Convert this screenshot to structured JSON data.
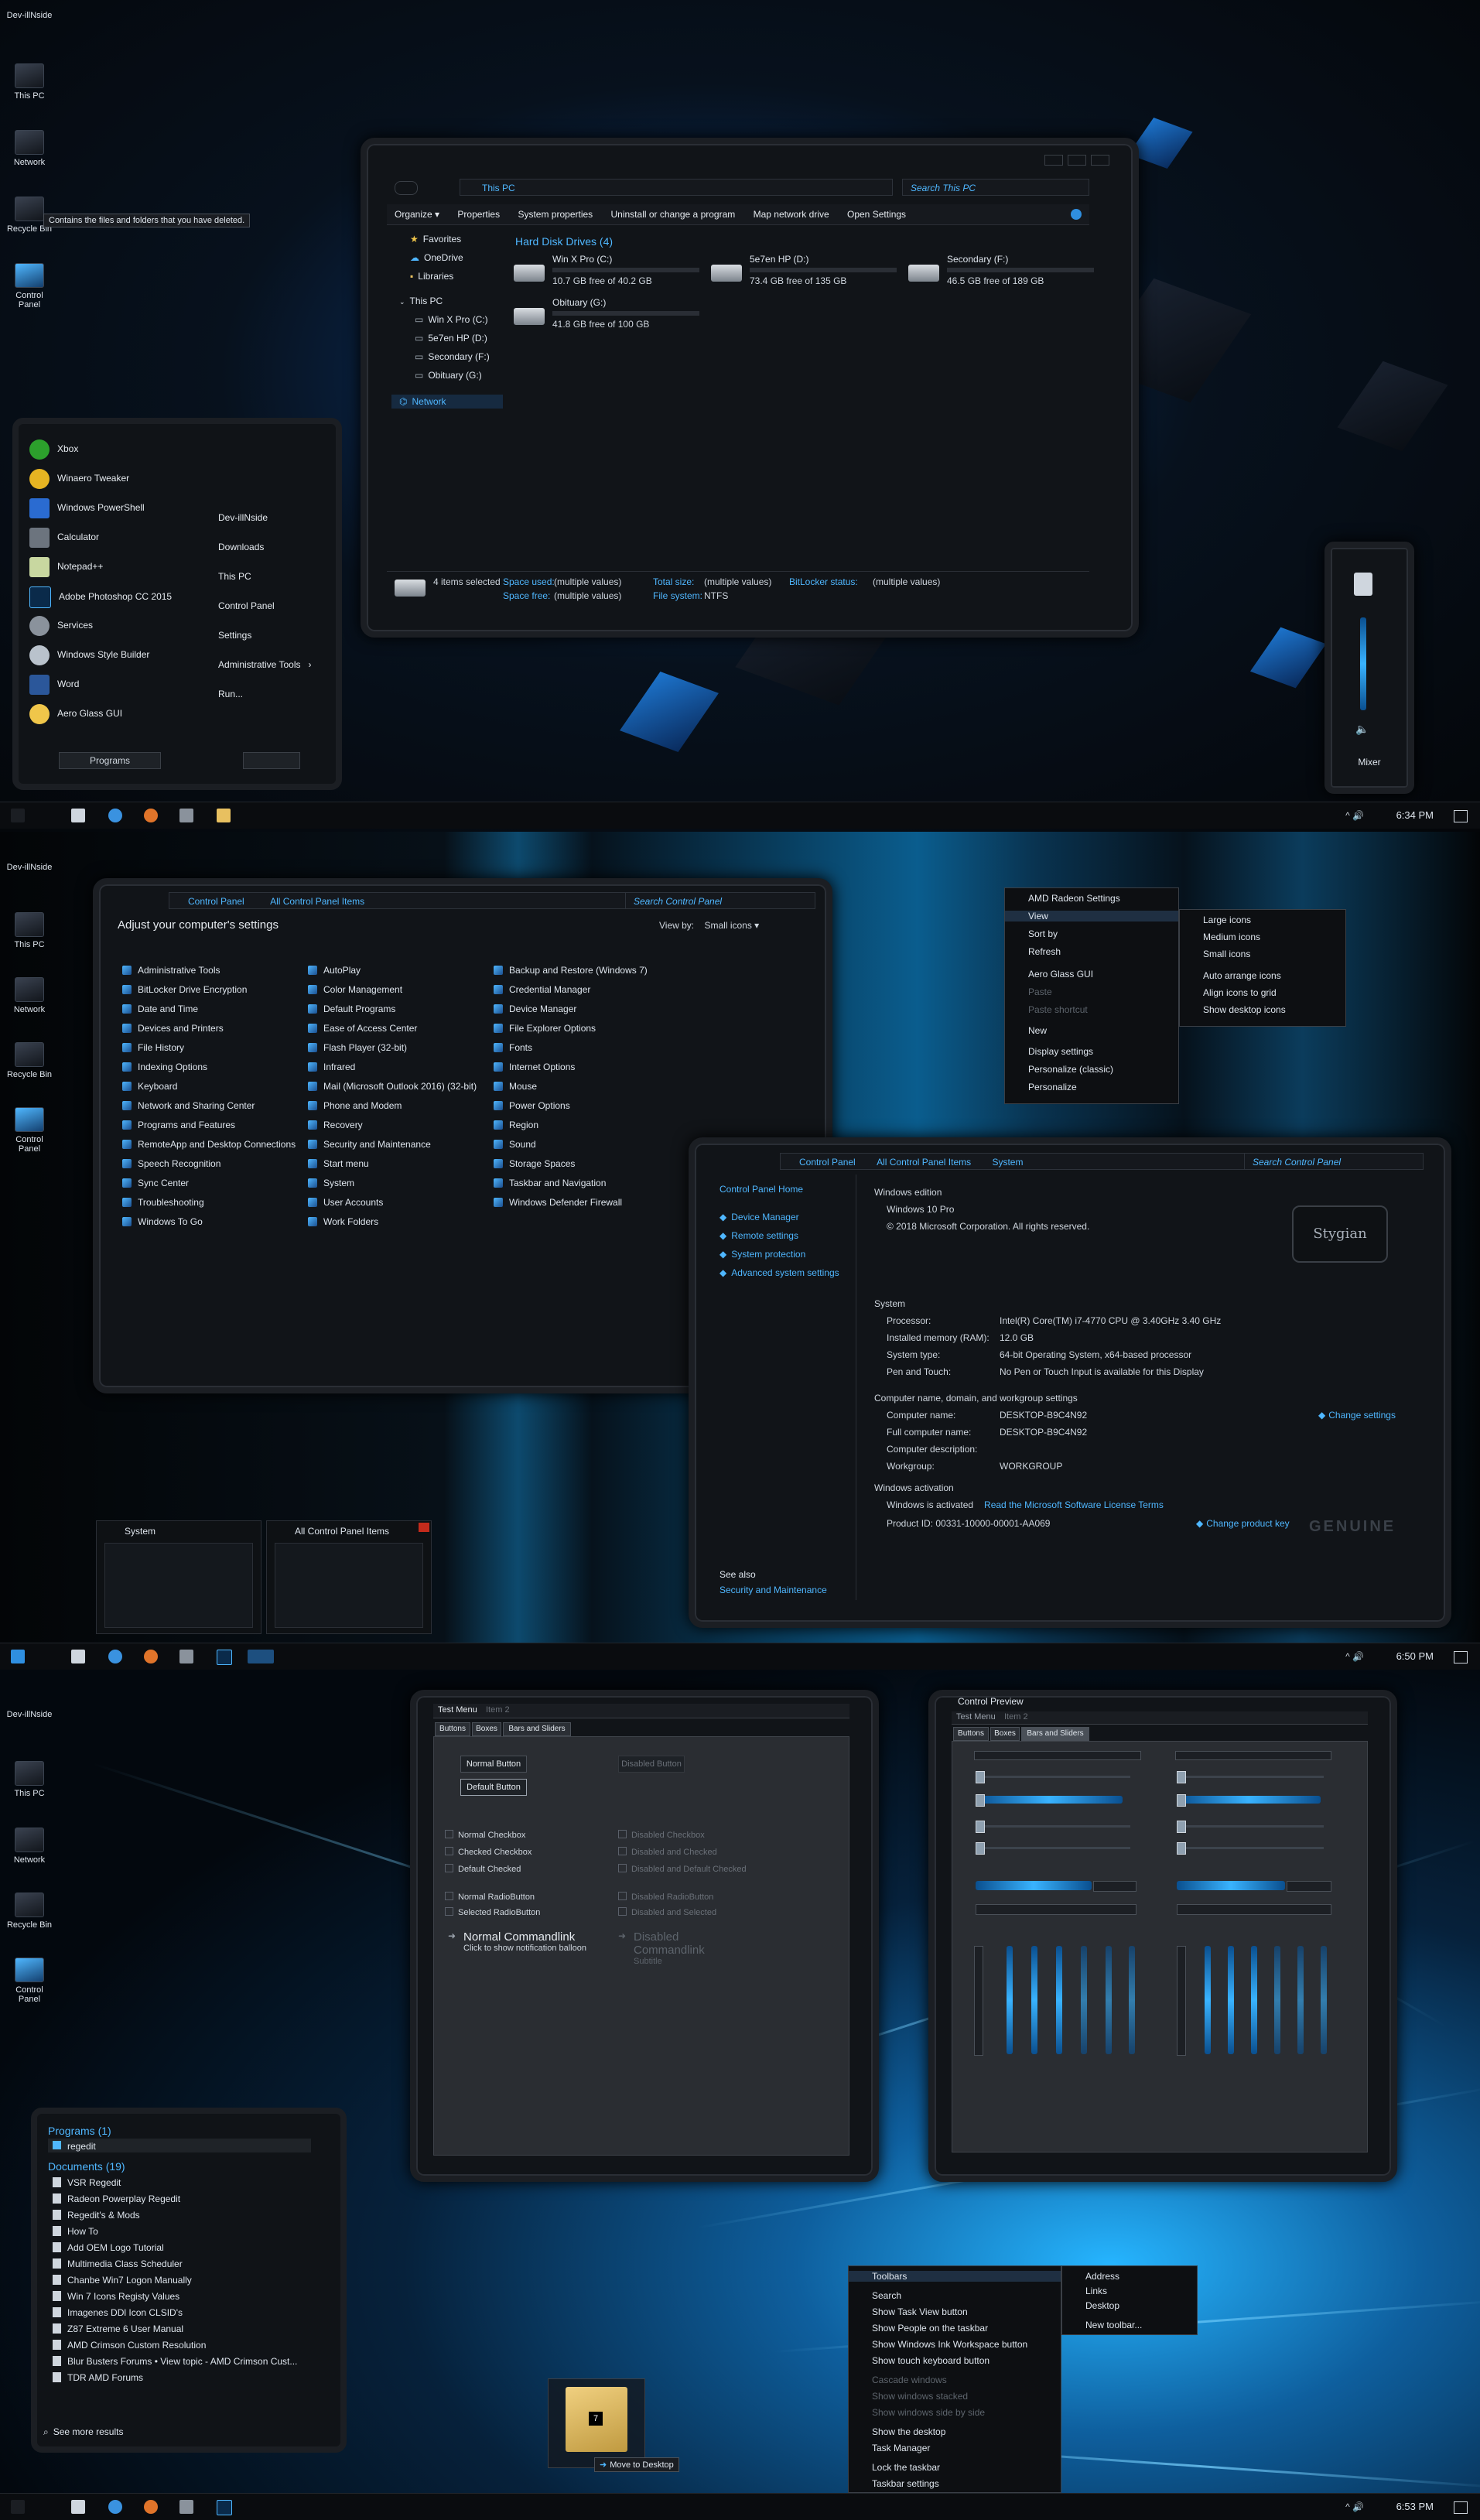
{
  "desktop": {
    "icons": [
      "Dev-illNside",
      "This PC",
      "Network",
      "Recycle Bin",
      "Control Panel"
    ],
    "recycle_tooltip": "Contains the files and folders that you have deleted."
  },
  "explorer": {
    "address": "This PC",
    "search_placeholder": "Search This PC",
    "toolbar": [
      "Organize ▾",
      "Properties",
      "System properties",
      "Uninstall or change a program",
      "Map network drive",
      "Open Settings"
    ],
    "nav": {
      "favorites": "Favorites",
      "onedrive": "OneDrive",
      "libraries": "Libraries",
      "thispc": "This PC",
      "drives": [
        "Win X Pro (C:)",
        "5e7en HP (D:)",
        "Secondary (F:)",
        "Obituary (G:)"
      ],
      "network": "Network"
    },
    "group_title": "Hard Disk Drives (4)",
    "drives": [
      {
        "name": "Win X Pro (C:)",
        "free": "10.7 GB free of 40.2 GB",
        "used_fraction": 0.73
      },
      {
        "name": "5e7en HP (D:)",
        "free": "73.4 GB free of 135 GB",
        "used_fraction": 0.46
      },
      {
        "name": "Secondary (F:)",
        "free": "46.5 GB free of 189 GB",
        "used_fraction": 0.75
      },
      {
        "name": "Obituary (G:)",
        "free": "41.8 GB free of 100 GB",
        "used_fraction": 0.58
      }
    ],
    "details": {
      "count": "4 items selected",
      "space_used_label": "Space used:",
      "space_used": "(multiple values)",
      "space_free_label": "Space free:",
      "space_free": "(multiple values)",
      "total_size_label": "Total size:",
      "total_size": "(multiple values)",
      "filesystem_label": "File system:",
      "filesystem": "NTFS",
      "bitlocker_label": "BitLocker status:",
      "bitlocker": "(multiple values)"
    }
  },
  "startmenu": {
    "left": [
      "Xbox",
      "Winaero Tweaker",
      "Windows PowerShell",
      "Calculator",
      "Notepad++",
      "Adobe Photoshop CC 2015",
      "Services",
      "Windows Style Builder",
      "Word",
      "Aero Glass GUI"
    ],
    "right": [
      "Dev-illNside",
      "Downloads",
      "This PC",
      "Control Panel",
      "Settings",
      "Administrative Tools",
      "Run..."
    ],
    "programs": "Programs"
  },
  "mixer": {
    "label": "Mixer"
  },
  "clock1": "6:34 PM",
  "clock2": "6:50 PM",
  "clock3": "6:53 PM",
  "controlpanel": {
    "crumbs": [
      "Control Panel",
      "All Control Panel Items"
    ],
    "search": "Search Control Panel",
    "heading": "Adjust your computer's settings",
    "viewby_label": "View by:",
    "viewby_value": "Small icons ▾",
    "col1": [
      "Administrative Tools",
      "BitLocker Drive Encryption",
      "Date and Time",
      "Devices and Printers",
      "File History",
      "Indexing Options",
      "Keyboard",
      "Network and Sharing Center",
      "Programs and Features",
      "RemoteApp and Desktop Connections",
      "Speech Recognition",
      "Sync Center",
      "Troubleshooting",
      "Windows To Go"
    ],
    "col2": [
      "AutoPlay",
      "Color Management",
      "Default Programs",
      "Ease of Access Center",
      "Flash Player (32-bit)",
      "Infrared",
      "Mail (Microsoft Outlook 2016) (32-bit)",
      "Phone and Modem",
      "Recovery",
      "Security and Maintenance",
      "Start menu",
      "System",
      "User Accounts",
      "Work Folders"
    ],
    "col3": [
      "Backup and Restore (Windows 7)",
      "Credential Manager",
      "Device Manager",
      "File Explorer Options",
      "Fonts",
      "Internet Options",
      "Mouse",
      "Power Options",
      "Region",
      "Sound",
      "Storage Spaces",
      "Taskbar and Navigation",
      "Windows Defender Firewall"
    ]
  },
  "desktop_ctx": {
    "items": [
      {
        "label": "AMD Radeon Settings",
        "disabled": false
      },
      {
        "label": "View",
        "disabled": false
      },
      {
        "label": "Sort by",
        "disabled": false
      },
      {
        "label": "Refresh",
        "disabled": false
      },
      {
        "label": "Aero Glass GUI",
        "disabled": false
      },
      {
        "label": "Paste",
        "disabled": true
      },
      {
        "label": "Paste shortcut",
        "disabled": true
      },
      {
        "label": "New",
        "disabled": false
      },
      {
        "label": "Display settings",
        "disabled": false
      },
      {
        "label": "Personalize (classic)",
        "disabled": false
      },
      {
        "label": "Personalize",
        "disabled": false
      }
    ],
    "view_sub": [
      "Large icons",
      "Medium icons",
      "Small icons",
      "Auto arrange icons",
      "Align icons to grid",
      "Show desktop icons"
    ]
  },
  "system": {
    "crumbs": [
      "Control Panel",
      "All Control Panel Items",
      "System"
    ],
    "search": "Search Control Panel",
    "home": "Control Panel Home",
    "links": [
      "Device Manager",
      "Remote settings",
      "System protection",
      "Advanced system settings"
    ],
    "see_also": "See also",
    "security": "Security and Maintenance",
    "edition_title": "Windows edition",
    "edition": "Windows 10 Pro",
    "copyright": "© 2018 Microsoft Corporation. All rights reserved.",
    "logo_text": "Stygian",
    "system_title": "System",
    "rows": [
      [
        "Processor:",
        "Intel(R) Core(TM) i7-4770 CPU @ 3.40GHz   3.40 GHz"
      ],
      [
        "Installed memory (RAM):",
        "12.0 GB"
      ],
      [
        "System type:",
        "64-bit Operating System, x64-based processor"
      ],
      [
        "Pen and Touch:",
        "No Pen or Touch Input is available for this Display"
      ]
    ],
    "comp_title": "Computer name, domain, and workgroup settings",
    "comp_rows": [
      [
        "Computer name:",
        "DESKTOP-B9C4N92"
      ],
      [
        "Full computer name:",
        "DESKTOP-B9C4N92"
      ],
      [
        "Computer description:",
        ""
      ],
      [
        "Workgroup:",
        "WORKGROUP"
      ]
    ],
    "change_settings": "Change settings",
    "activation_title": "Windows activation",
    "activated": "Windows is activated",
    "license_link": "Read the Microsoft Software License Terms",
    "product_id": "Product ID: 00331-10000-00001-AA069",
    "change_key": "Change product key",
    "genuine": "GENUINE"
  },
  "thumbs": [
    "System",
    "All Control Panel Items"
  ],
  "testwin": {
    "menu": [
      "Test Menu",
      "Item 2"
    ],
    "tabs": [
      "Buttons",
      "Boxes",
      "Bars and Sliders"
    ],
    "normal_button": "Normal Button",
    "default_button": "Default Button",
    "disabled_button": "Disabled Button",
    "checks": [
      "Normal Checkbox",
      "Checked Checkbox",
      "Default Checked"
    ],
    "checks_dis": [
      "Disabled Checkbox",
      "Disabled and Checked",
      "Disabled and Default Checked"
    ],
    "radios": [
      "Normal RadioButton",
      "Selected RadioButton"
    ],
    "radios_dis": [
      "Disabled RadioButton",
      "Disabled and Selected"
    ],
    "cmd_title": "Normal Commandlink",
    "cmd_sub": "Click to show notification balloon",
    "cmd_dis_title": "Disabled Commandlink",
    "cmd_dis_sub": "Subtitle"
  },
  "preview": {
    "title": "Control Preview",
    "menu": [
      "Test Menu",
      "Item 2"
    ],
    "tabs": [
      "Buttons",
      "Boxes",
      "Bars and Sliders"
    ]
  },
  "search_results": {
    "programs_title": "Programs (1)",
    "programs": [
      "regedit"
    ],
    "docs_title": "Documents (19)",
    "docs": [
      "VSR Regedit",
      "Radeon Powerplay Regedit",
      "Regedit's & Mods",
      "How To",
      "Add OEM Logo Tutorial",
      "Multimedia Class Scheduler",
      "Chanbe Win7 Logon Manually",
      "Win 7 Icons Registy Values",
      "Imagenes DDl Icon CLSID's",
      "Z87 Extreme 6 User Manual",
      "AMD Crimson Custom Resolution",
      "Blur Busters Forums • View topic - AMD Crimson Cust...",
      "TDR AMD Forums"
    ],
    "more": "See more results"
  },
  "drag": {
    "badge": "7",
    "label": "Move to Desktop"
  },
  "taskbar_ctx": {
    "items": [
      {
        "label": "Toolbars",
        "disabled": false
      },
      {
        "label": "Search",
        "disabled": false
      },
      {
        "label": "Show Task View button",
        "disabled": false
      },
      {
        "label": "Show People on the taskbar",
        "disabled": false
      },
      {
        "label": "Show Windows Ink Workspace button",
        "disabled": false
      },
      {
        "label": "Show touch keyboard button",
        "disabled": false
      },
      {
        "label": "Cascade windows",
        "disabled": true
      },
      {
        "label": "Show windows stacked",
        "disabled": true
      },
      {
        "label": "Show windows side by side",
        "disabled": true
      },
      {
        "label": "Show the desktop",
        "disabled": false
      },
      {
        "label": "Task Manager",
        "disabled": false
      },
      {
        "label": "Lock the taskbar",
        "disabled": false
      },
      {
        "label": "Taskbar settings",
        "disabled": false
      }
    ],
    "toolbars_sub": [
      "Address",
      "Links",
      "Desktop",
      "New toolbar..."
    ]
  }
}
